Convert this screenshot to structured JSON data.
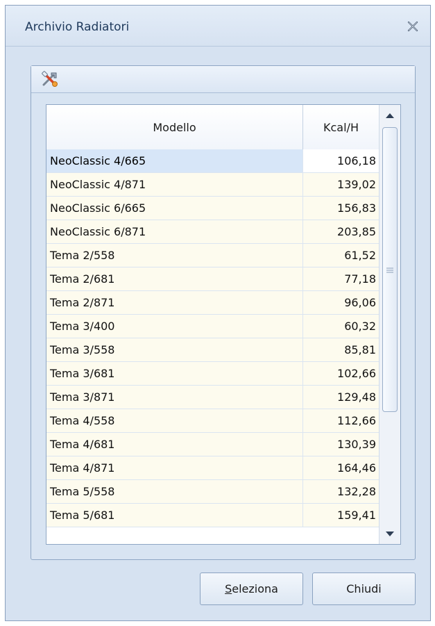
{
  "window": {
    "title": "Archivio Radiatori",
    "close_icon": "close-icon"
  },
  "group": {
    "icon": "tools-icon"
  },
  "grid": {
    "columns": [
      "Modello",
      "Kcal/H"
    ],
    "rows": [
      {
        "modello": "NeoClassic 4/665",
        "kcal": "106,18",
        "selected": true
      },
      {
        "modello": "NeoClassic 4/871",
        "kcal": "139,02"
      },
      {
        "modello": "NeoClassic 6/665",
        "kcal": "156,83"
      },
      {
        "modello": "NeoClassic 6/871",
        "kcal": "203,85"
      },
      {
        "modello": "Tema 2/558",
        "kcal": "61,52"
      },
      {
        "modello": "Tema 2/681",
        "kcal": "77,18"
      },
      {
        "modello": "Tema 2/871",
        "kcal": "96,06"
      },
      {
        "modello": "Tema 3/400",
        "kcal": "60,32"
      },
      {
        "modello": "Tema 3/558",
        "kcal": "85,81"
      },
      {
        "modello": "Tema 3/681",
        "kcal": "102,66"
      },
      {
        "modello": "Tema 3/871",
        "kcal": "129,48"
      },
      {
        "modello": "Tema 4/558",
        "kcal": "112,66"
      },
      {
        "modello": "Tema 4/681",
        "kcal": "130,39"
      },
      {
        "modello": "Tema 4/871",
        "kcal": "164,46"
      },
      {
        "modello": "Tema 5/558",
        "kcal": "132,28"
      },
      {
        "modello": "Tema 5/681",
        "kcal": "159,41"
      }
    ]
  },
  "buttons": {
    "seleziona": {
      "mnemonic": "S",
      "rest": "eleziona"
    },
    "chiudi": "Chiudi"
  },
  "colors": {
    "row_background": "#fdfbee",
    "selected_row": "#d7e6f8",
    "window_background": "#d6e2f1",
    "title_text": "#1e395b"
  }
}
